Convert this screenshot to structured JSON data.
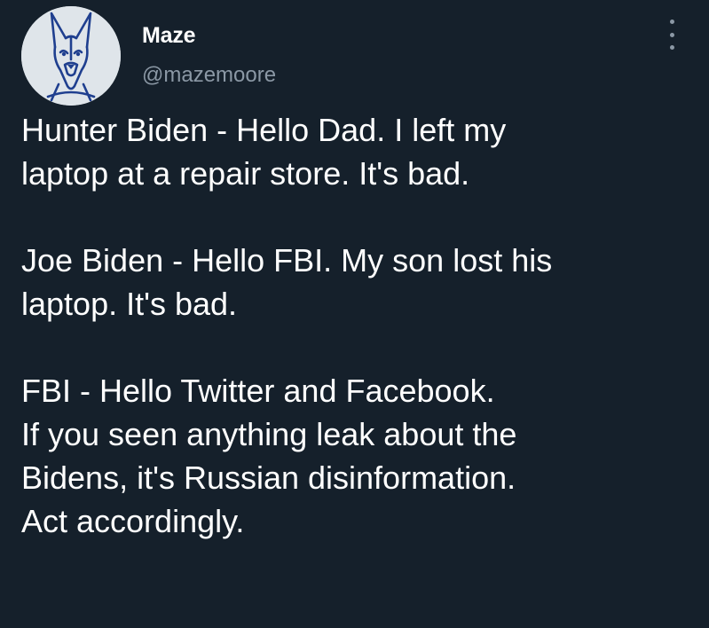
{
  "author": {
    "display_name": "Maze",
    "handle": "@mazemoore",
    "avatar_icon": "doberman-avatar",
    "avatar_bg": "#dfe5ea",
    "avatar_line_color": "#1f3f8f"
  },
  "menu": {
    "more_icon": "more-vertical-icon"
  },
  "tweet": {
    "paragraphs": [
      [
        "Hunter Biden - Hello Dad. I left my",
        "laptop at a repair store. It's bad."
      ],
      [
        "Joe Biden - Hello FBI. My son lost his",
        "laptop. It's bad."
      ],
      [
        "FBI - Hello Twitter and Facebook.",
        "If you seen anything leak about the",
        "Bidens, it's Russian disinformation.",
        "Act accordingly."
      ]
    ]
  },
  "colors": {
    "background": "#15202b",
    "primary_text": "#ffffff",
    "secondary_text": "#8b98a5"
  }
}
